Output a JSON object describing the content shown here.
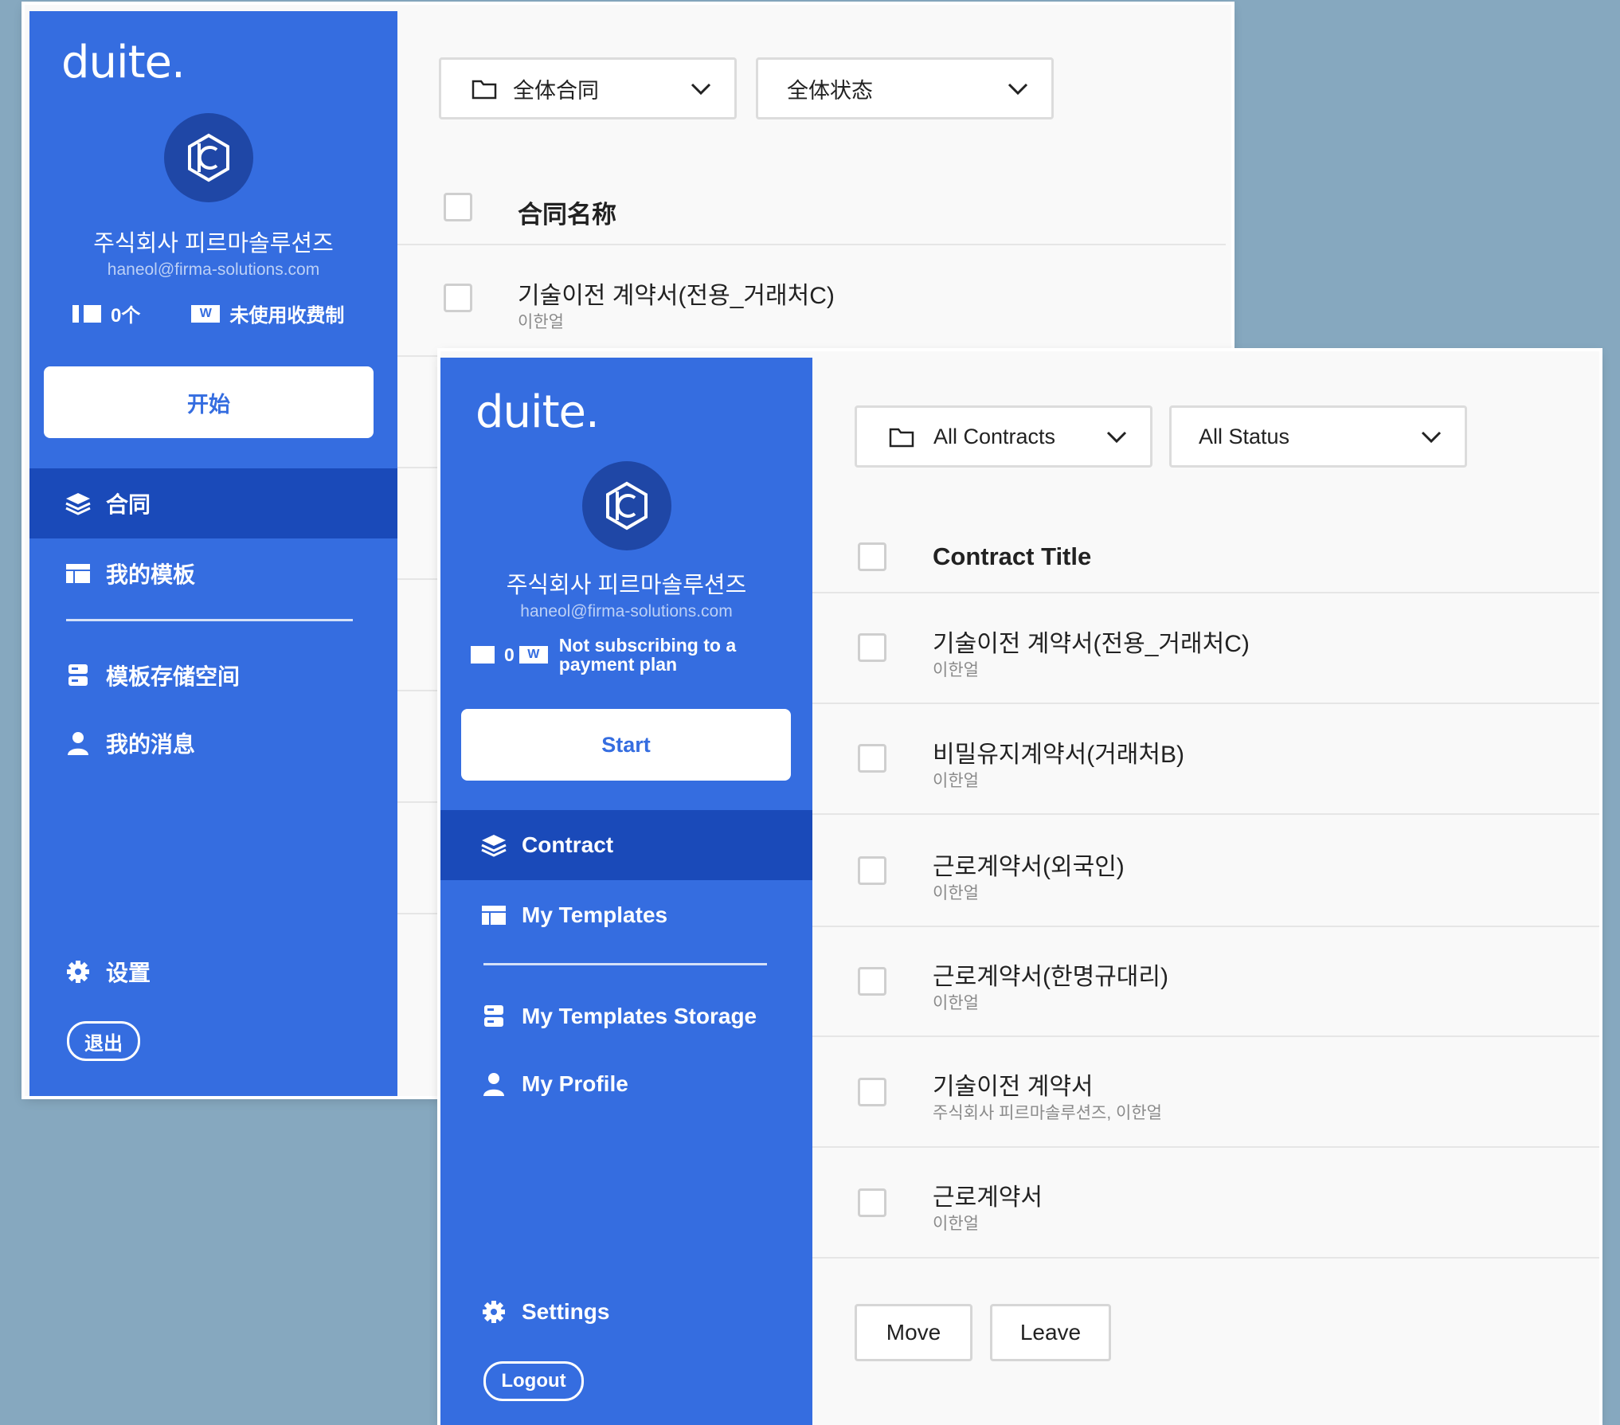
{
  "back_window": {
    "logo": "duite.",
    "company": "주식회사 피르마솔루션즈",
    "email": "haneol@firma-solutions.com",
    "stat_count": "0个",
    "stat_plan": "未使用收费制",
    "start_label": "开始",
    "nav": {
      "contract": "合同",
      "my_templates": "我的模板",
      "templates_storage": "模板存储空间",
      "my_profile": "我的消息"
    },
    "settings": "设置",
    "logout": "退出",
    "filter_contracts": "全体合同",
    "filter_status": "全体状态",
    "column_header": "合同名称",
    "rows": [
      {
        "title": "기술이전 계약서(전용_거래처C)",
        "sub": "이한얼"
      }
    ]
  },
  "front_window": {
    "logo": "duite.",
    "company": "주식회사 피르마솔루션즈",
    "email": "haneol@firma-solutions.com",
    "stat_count": "0",
    "stat_plan_line1": "Not subscribing to a",
    "stat_plan_line2": "payment plan",
    "start_label": "Start",
    "nav": {
      "contract": "Contract",
      "my_templates": "My Templates",
      "templates_storage": "My Templates Storage",
      "my_profile": "My Profile"
    },
    "settings": "Settings",
    "logout": "Logout",
    "filter_contracts": "All Contracts",
    "filter_status": "All Status",
    "column_header": "Contract Title",
    "rows": [
      {
        "title": "기술이전 계약서(전용_거래처C)",
        "sub": "이한얼"
      },
      {
        "title": "비밀유지계약서(거래처B)",
        "sub": "이한얼"
      },
      {
        "title": "근로계약서(외국인)",
        "sub": "이한얼"
      },
      {
        "title": "근로계약서(한명규대리)",
        "sub": "이한얼"
      },
      {
        "title": "기술이전 계약서",
        "sub": "주식회사 피르마솔루션즈, 이한얼"
      },
      {
        "title": "근로계약서",
        "sub": "이한얼"
      }
    ],
    "move_label": "Move",
    "leave_label": "Leave"
  },
  "colors": {
    "sidebar": "#356de0",
    "sidebar_active": "#1a4ab9",
    "avatar": "#1f47a6",
    "background": "#86a8bf"
  },
  "icons": [
    "folder-icon",
    "chevron-down-icon",
    "layers-icon",
    "table-icon",
    "storage-icon",
    "user-icon",
    "gear-icon",
    "doc-count-icon",
    "won-icon",
    "brand-mark-icon"
  ]
}
